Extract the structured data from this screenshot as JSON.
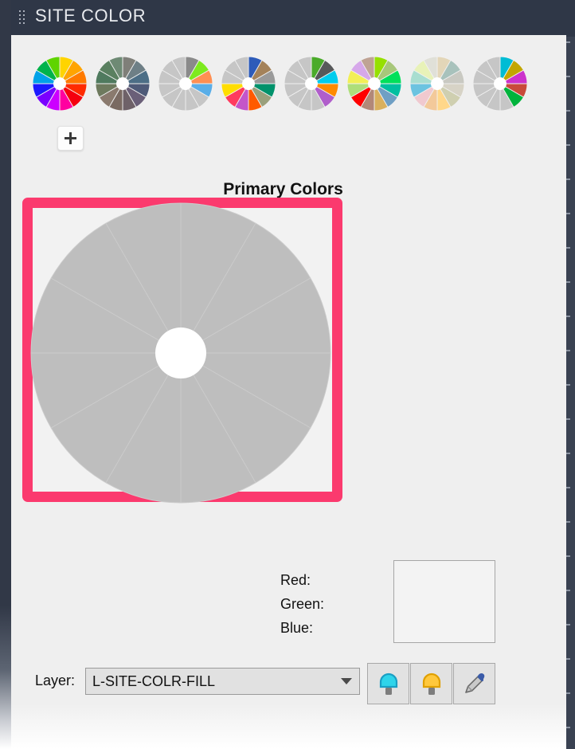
{
  "window": {
    "title": "SITE COLOR",
    "drag_handle_icon": "drag-dots-icon",
    "title_bar_color": "#2f3747"
  },
  "palette": {
    "add_button_icon": "plus-icon",
    "swatches": [
      {
        "name": "rainbow-full",
        "colors": [
          "#ffd400",
          "#ffa400",
          "#ff7a00",
          "#ff2b00",
          "#f5000e",
          "#ff00a0",
          "#cc00ff",
          "#7a00ff",
          "#1b19ff",
          "#00a2e8",
          "#00b34a",
          "#5fd400"
        ]
      },
      {
        "name": "muted-forest",
        "colors": [
          "#7f7f79",
          "#6e7f86",
          "#4c6e86",
          "#4e5a78",
          "#6a5f78",
          "#6e6168",
          "#7a6a62",
          "#8a7a6e",
          "#6e7a5e",
          "#4f7a5e",
          "#5a8060",
          "#6e8a74"
        ]
      },
      {
        "name": "gray-spring",
        "colors": [
          "#8a8a8a",
          "#7dea1e",
          "#ff8f52",
          "#5aaee8",
          "#c6c6c6",
          "#c6c6c6",
          "#c6c6c6",
          "#c6c6c6",
          "#c6c6c6",
          "#c6c6c6",
          "#c6c6c6",
          "#c6c6c6"
        ]
      },
      {
        "name": "primary-accent",
        "colors": [
          "#2d5bb9",
          "#a4825a",
          "#9a9a9a",
          "#00926b",
          "#9aa07c",
          "#ff5a00",
          "#c455c9",
          "#ff3a5e",
          "#ffdd00",
          "#c6c6c6",
          "#c6c6c6",
          "#c6c6c6"
        ]
      },
      {
        "name": "gray-pop",
        "colors": [
          "#4aab2a",
          "#57585a",
          "#00ccee",
          "#ff8a00",
          "#b05ecb",
          "#c6c6c6",
          "#c6c6c6",
          "#c6c6c6",
          "#c6c6c6",
          "#c6c6c6",
          "#c6c6c6",
          "#c6c6c6"
        ]
      },
      {
        "name": "bright-mix",
        "colors": [
          "#96e000",
          "#a8c77a",
          "#00e05a",
          "#00bfa0",
          "#6f9fc4",
          "#d9b05e",
          "#b28878",
          "#ff0000",
          "#aede7a",
          "#f2ef56",
          "#d6a8ea",
          "#bfa394"
        ]
      },
      {
        "name": "pastel-soft",
        "colors": [
          "#e3d6b8",
          "#a8c2bc",
          "#c9c9c2",
          "#d7d3c6",
          "#cfcfb0",
          "#ffd78a",
          "#f3c99a",
          "#f0c9cf",
          "#6cc3e0",
          "#a9ded0",
          "#e8f2b8",
          "#e0e0d8"
        ]
      },
      {
        "name": "gray-jewel",
        "colors": [
          "#00bcd4",
          "#c2a600",
          "#cc33cc",
          "#c94a3a",
          "#00b33c",
          "#c6c6c6",
          "#c6c6c6",
          "#c6c6c6",
          "#c6c6c6",
          "#c6c6c6",
          "#c6c6c6",
          "#c6c6c6"
        ]
      }
    ]
  },
  "primary_section": {
    "heading": "Primary Colors",
    "selected_border_color": "#fb3a6e",
    "wheel": {
      "name": "primary-colors-wheel",
      "segment_count": 12,
      "colors": [
        "#bebebe",
        "#bebebe",
        "#bebebe",
        "#bebebe",
        "#bebebe",
        "#bebebe",
        "#bebebe",
        "#bebebe",
        "#bebebe",
        "#bebebe",
        "#bebebe",
        "#bebebe"
      ]
    }
  },
  "rgb_readout": {
    "red_label": "Red:",
    "red_value": "",
    "green_label": "Green:",
    "green_value": "",
    "blue_label": "Blue:",
    "blue_value": "",
    "preview_color": "#f3f3f3"
  },
  "bottom_bar": {
    "layer_label": "Layer:",
    "layer_value": "L-SITE-COLR-FILL",
    "layer_caret_icon": "chevron-down-icon",
    "buttons": [
      {
        "name": "light-cool-button",
        "icon": "lightbulb-cool-icon",
        "color": "#2fd4ea"
      },
      {
        "name": "light-warm-button",
        "icon": "lightbulb-warm-icon",
        "color": "#ffc83d"
      },
      {
        "name": "eyedropper-button",
        "icon": "eyedropper-icon",
        "color": "#3a5ba8"
      }
    ]
  }
}
